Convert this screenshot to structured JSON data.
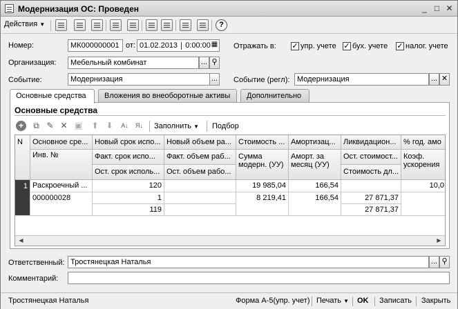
{
  "window": {
    "title": "Модернизация ОС: Проведен",
    "min_icon": "minimize-icon",
    "max_icon": "maximize-icon",
    "close_icon": "close-icon"
  },
  "toolbar": {
    "actions_label": "Действия"
  },
  "form": {
    "number_label": "Номер:",
    "number_value": "МК000000001",
    "from_label": "от:",
    "date_value": "01.02.2013",
    "time_value": "0:00:00",
    "reflect_label": "Отражать в:",
    "checks": [
      {
        "label": "упр. учете",
        "checked": "✓"
      },
      {
        "label": "бух. учете",
        "checked": "✓"
      },
      {
        "label": "налог. учете",
        "checked": "✓"
      }
    ],
    "org_label": "Организация:",
    "org_value": "Мебельный комбинат",
    "event_label": "Событие:",
    "event_value": "Модернизация",
    "event_reg_label": "Событие (регл):",
    "event_reg_value": "Модернизация",
    "responsible_label": "Ответственный:",
    "responsible_value": "Тростянецкая Наталья",
    "comment_label": "Комментарий:",
    "comment_value": ""
  },
  "tabs": [
    {
      "label": "Основные средства"
    },
    {
      "label": "Вложения во внеоборотные активы"
    },
    {
      "label": "Дополнительно"
    }
  ],
  "panel": {
    "title": "Основные средства",
    "fill_label": "Заполнить",
    "select_label": "Подбор"
  },
  "grid": {
    "headers": {
      "n": "N",
      "c1": [
        "Основное сре...",
        "Инв. №"
      ],
      "c2": [
        "Новый срок испо...",
        "Факт. срок испо...",
        "Ост. срок исполь..."
      ],
      "c3": [
        "Новый объем ра...",
        "Факт. объем раб...",
        "Ост. объем рабо..."
      ],
      "c4": [
        "Стоимость ...",
        "Сумма модерн. (УУ)"
      ],
      "c5": [
        "Амортизац...",
        "Аморт. за месяц (УУ)"
      ],
      "c6": [
        "Ликвидацион...",
        "Ост. стоимост...",
        "Стоимость дл..."
      ],
      "c7": [
        "% год. амо",
        "Коэф. ускорения"
      ]
    },
    "row": {
      "n": "1",
      "asset": "Раскроечный ...",
      "inv": "000000028",
      "new_term": "120",
      "fact_term": "1",
      "rest_term": "119",
      "cost": "19 985,04",
      "modern_sum": "8 219,41",
      "amort1": "166,54",
      "amort2": "166,54",
      "liq1": "27 871,37",
      "liq2": "27 871,37",
      "pct": "10,0"
    }
  },
  "status": {
    "user": "Тростянецкая Наталья",
    "form_a5": "Форма А-5(упр. учет)",
    "print": "Печать",
    "ok": "OK",
    "save": "Записать",
    "close": "Закрыть"
  }
}
